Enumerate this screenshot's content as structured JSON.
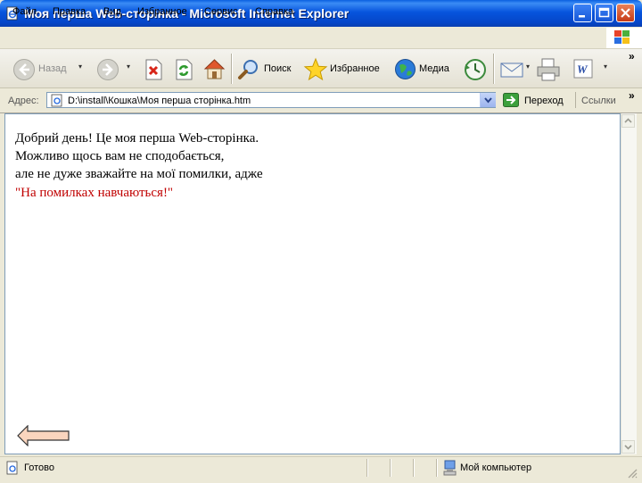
{
  "window": {
    "title": "Моя перша Web-сторінка - Microsoft Internet Explorer"
  },
  "menubar": {
    "items": [
      "Файл",
      "Правка",
      "Вид",
      "Избранное",
      "Сервис",
      "Справка"
    ]
  },
  "toolbar": {
    "back_label": "Назад",
    "search_label": "Поиск",
    "favorites_label": "Избранное",
    "media_label": "Медиа",
    "overflow": "»"
  },
  "addressbar": {
    "label": "Адрес:",
    "value": "D:\\install\\Кошка\\Моя перша сторінка.htm",
    "go_label": "Переход",
    "links_label": "Ссылки",
    "overflow": "»"
  },
  "page": {
    "lines": [
      "Добрий день! Це моя перша Web-сторінка.",
      "Можливо щось вам не сподобається,",
      "але не дуже зважайте на мої помилки, адже",
      "\"На помилках навчаються!\""
    ],
    "quote_color": "#C00000"
  },
  "statusbar": {
    "status": "Готово",
    "zone": "Мой компьютер"
  },
  "colors": {
    "titlebar": "#0754DD",
    "chrome": "#ECE9D8"
  }
}
